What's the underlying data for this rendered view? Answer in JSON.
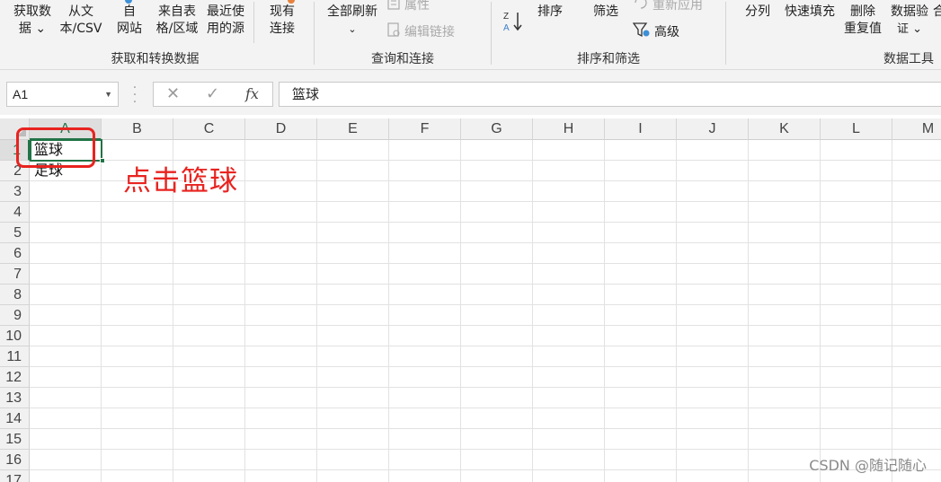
{
  "ribbon": {
    "groups": [
      {
        "label": "获取和转换数据"
      },
      {
        "label": "查询和连接"
      },
      {
        "label": "排序和筛选"
      },
      {
        "label": "数据工具"
      }
    ],
    "buttons": {
      "get_data": [
        "获取数",
        "据 ⌄"
      ],
      "from_text": [
        "从文",
        "本/CSV"
      ],
      "from_web": [
        "自",
        "网站"
      ],
      "from_table": [
        "来自表",
        "格/区域"
      ],
      "recent_sources": [
        "最近使",
        "用的源"
      ],
      "existing_conn": [
        "现有",
        "连接"
      ],
      "refresh_all": [
        "全部刷新",
        "⌄"
      ],
      "properties": "属性",
      "edit_links": "编辑链接",
      "sort": "排序",
      "filter": "筛选",
      "reapply": "重新应用",
      "advanced": "高级",
      "split": "分列",
      "flash_fill": "快速填充",
      "remove_dup": [
        "删除",
        "重复值"
      ],
      "validation": [
        "数据验",
        "证 ⌄"
      ],
      "merge_partial": "合"
    }
  },
  "formula_bar": {
    "name_box": "A1",
    "cancel_icon": "✕",
    "enter_icon": "✓",
    "fx_icon": "fx",
    "content": "篮球"
  },
  "sheet": {
    "columns": [
      "A",
      "B",
      "C",
      "D",
      "E",
      "F",
      "G",
      "H",
      "I",
      "J",
      "K",
      "L",
      "M"
    ],
    "rows": [
      "1",
      "2",
      "3",
      "4",
      "5",
      "6",
      "7",
      "8",
      "9",
      "10",
      "11",
      "12",
      "13",
      "14",
      "15",
      "16",
      "17"
    ],
    "cells": {
      "A1": "篮球",
      "A2": "足球"
    },
    "selected_cell": "A1"
  },
  "annotation": "点击篮球",
  "watermark": "CSDN @随记随心",
  "colors": {
    "accent": "#217346",
    "annotation": "#e8231f"
  }
}
